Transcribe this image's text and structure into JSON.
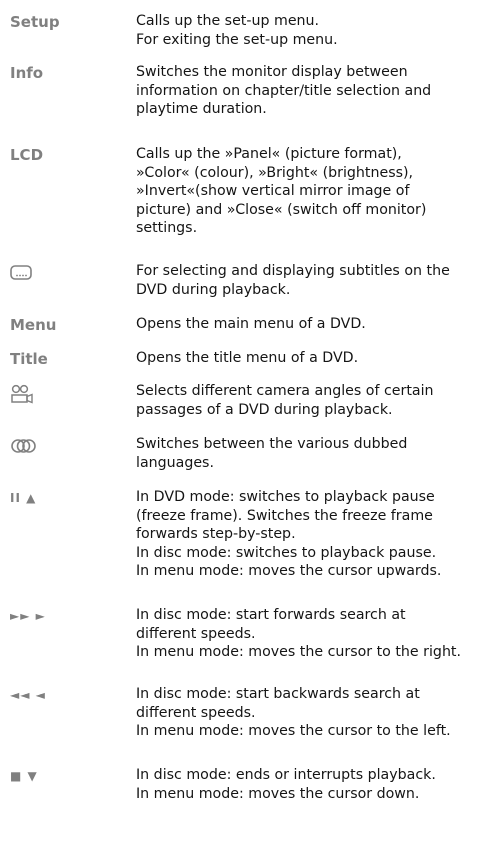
{
  "entries": [
    {
      "key": "Setup",
      "lines": [
        "Calls up the set-up menu.",
        "For exiting the set-up menu."
      ]
    },
    {
      "key": "Info",
      "lines": [
        "Switches the monitor display between",
        "information on chapter/title selection and",
        "playtime duration."
      ]
    },
    {
      "key": "LCD",
      "lines": [
        "Calls up the »Panel« (picture format),",
        "»Color« (colour), »Bright« (brightness),",
        "»Invert«(show vertical mirror image of",
        "picture) and »Close« (switch off monitor)",
        "settings."
      ]
    },
    {
      "icon": "subtitle-icon",
      "lines": [
        "For selecting and displaying subtitles on the",
        "DVD during playback."
      ]
    },
    {
      "key": "Menu",
      "lines": [
        "Opens the main menu of a DVD."
      ]
    },
    {
      "key": "Title",
      "lines": [
        "Opens the title menu of a DVD."
      ]
    },
    {
      "icon": "camera-angle-icon",
      "lines": [
        "Selects different camera angles of certain",
        "passages of a DVD during playback."
      ]
    },
    {
      "icon": "audio-language-icon",
      "lines": [
        "Switches between the various dubbed",
        "languages."
      ]
    },
    {
      "key": "II ▲",
      "icon": "pause-up-icon",
      "lines": [
        "In DVD mode: switches to playback pause",
        "(freeze frame). Switches the freeze frame",
        "forwards step-by-step.",
        "In disc mode: switches to playback pause.",
        "In menu mode: moves the cursor upwards."
      ]
    },
    {
      "key": "►► ►",
      "icon": "fast-forward-right-icon",
      "lines": [
        "In disc mode: start forwards search at",
        "different speeds.",
        "In menu mode: moves the cursor to the right."
      ]
    },
    {
      "key": "◄◄ ◄",
      "icon": "rewind-left-icon",
      "lines": [
        "In disc mode: start backwards search at",
        "different speeds.",
        "In menu mode: moves the cursor to the left."
      ]
    },
    {
      "key": "■ ▼",
      "icon": "stop-down-icon",
      "lines": [
        "In disc mode: ends or interrupts playback.",
        "In menu mode: moves the cursor down."
      ]
    }
  ],
  "colors": {
    "label": "#808080",
    "text": "#151515"
  }
}
